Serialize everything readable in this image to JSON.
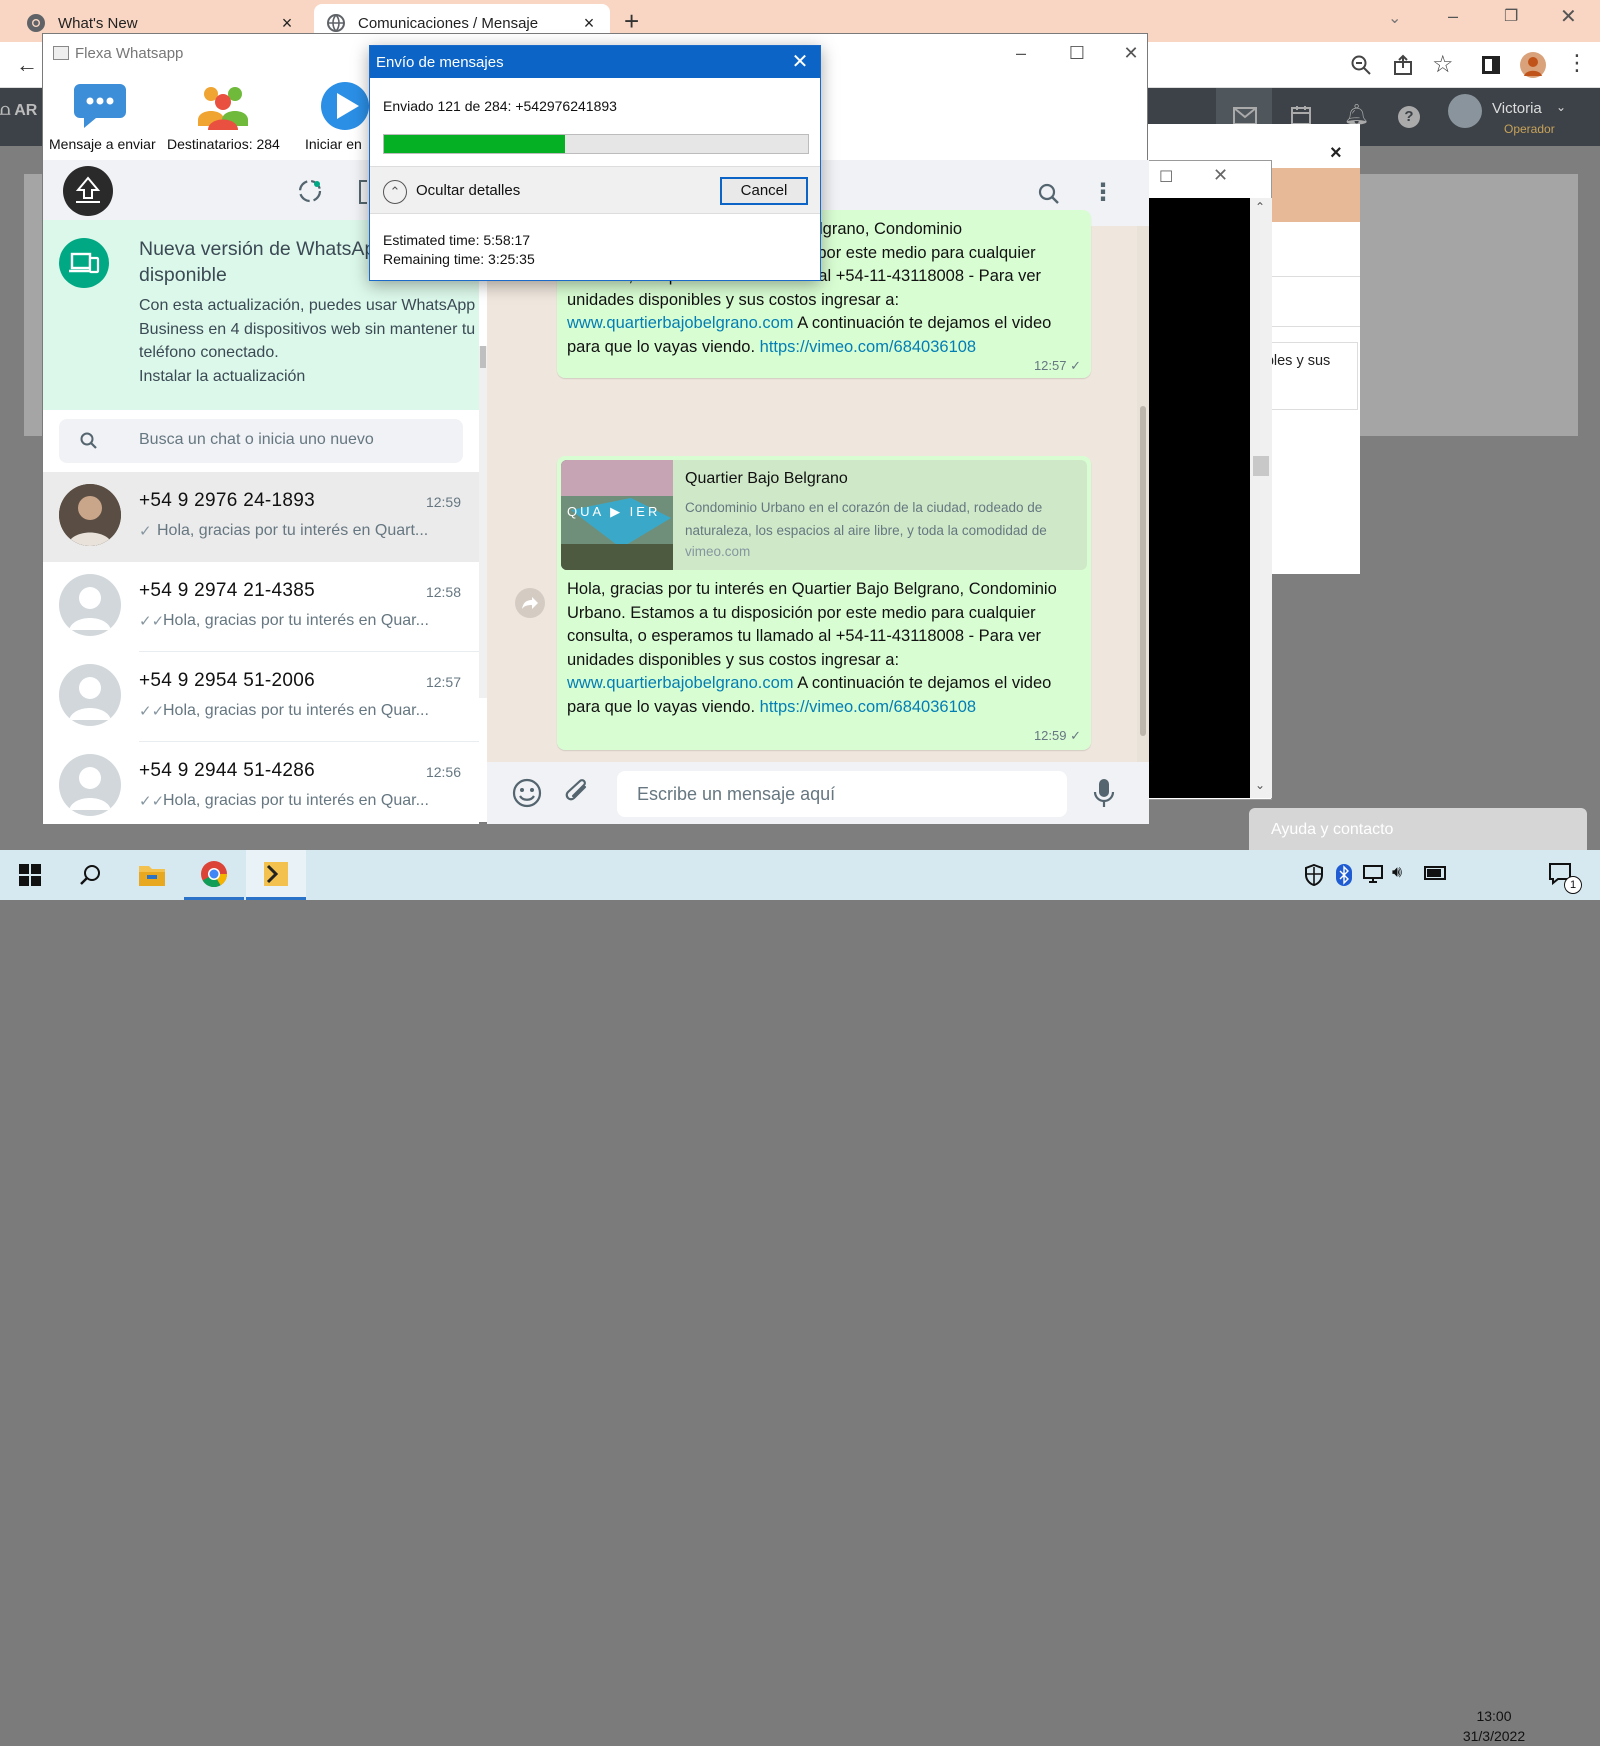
{
  "browser": {
    "tabs": [
      {
        "label": "What's New",
        "close": "×"
      },
      {
        "label": "Comunicaciones / Mensaje",
        "close": "×"
      }
    ],
    "new_tab": "+"
  },
  "web": {
    "user_name": "Victoria",
    "user_role": "Operador",
    "modal_close": "×",
    "behind_text": "unidades disponibles y sus",
    "help": "Ayuda y contacto"
  },
  "flexa": {
    "title": "Flexa Whatsapp",
    "toolbar": [
      {
        "label": "Mensaje a enviar"
      },
      {
        "label": "Destinatarios: 284"
      },
      {
        "label": "Iniciar en"
      }
    ]
  },
  "whatsapp": {
    "banner": {
      "title": "Nueva versión de WhatsApp disponible",
      "body": "Con esta actualización, puedes usar WhatsApp Business en 4 dispositivos web sin mantener tu teléfono conectado.",
      "action": "Instalar la actualización"
    },
    "search_placeholder": "Busca un chat o inicia uno nuevo",
    "chats": [
      {
        "name": "+54 9 2976 24-1893",
        "time": "12:59",
        "message": "Hola, gracias por tu interés en Quart..."
      },
      {
        "name": "+54 9 2974 21-4385",
        "time": "12:58",
        "message": "Hola, gracias por tu interés en Quar..."
      },
      {
        "name": "+54 9 2954 51-2006",
        "time": "12:57",
        "message": "Hola, gracias por tu interés en Quar..."
      },
      {
        "name": "+54 9 2944 51-4286",
        "time": "12:56",
        "message": "Hola, gracias por tu interés en Quar..."
      }
    ],
    "messages": [
      {
        "partial_top": "Quartier Bajo Belgrano, Condominio",
        "text": "Urbano. Estamos a tu disposición por este medio para cualquier\nconsulta, o esperamos tu llamado al +54-11-43118008  - Para ver\nunidades disponibles y sus costos ingresar a:",
        "link1": "www.quartierbajobelgrano.com",
        "middle": " A continuación te dejamos el video",
        "prefix2": "para que lo vayas viendo. ",
        "link2": "https://vimeo.com/684036108",
        "time": "12:57 ✓"
      },
      {
        "preview_title": "Quartier Bajo Belgrano",
        "preview_desc": "Condominio Urbano en el corazón de la ciudad, rodeado de naturaleza, los espacios al aire libre, y toda la comodidad de",
        "preview_domain": "vimeo.com",
        "preview_thumb_text": "QUA ▶ IER",
        "text": "Hola, gracias por tu interés en Quartier Bajo Belgrano, Condominio\nUrbano. Estamos a tu disposición por este medio para cualquier\nconsulta, o esperamos tu llamado al +54-11-43118008  - Para ver\nunidades disponibles y sus costos ingresar a:",
        "link1": "www.quartierbajobelgrano.com",
        "middle": " A continuación te dejamos el video",
        "prefix2": "para que lo vayas viendo. ",
        "link2": "https://vimeo.com/684036108",
        "time": "12:59 ✓"
      }
    ],
    "compose_placeholder": "Escribe un mensaje aquí"
  },
  "dialog": {
    "title": "Envío de mensajes",
    "status": "Enviado 121 de 284: +542976241893",
    "progress": 0.426,
    "details_toggle": "Ocultar detalles",
    "cancel": "Cancel",
    "estimated": "Estimated time: 5:58:17",
    "remaining": "Remaining time: 3:25:35"
  },
  "taskbar": {
    "time": "13:00",
    "date": "31/3/2022",
    "notification_count": "1"
  },
  "colors": {
    "whatsapp_green": "#00a884",
    "dialog_blue": "#0c65c6",
    "progress_green": "#06b025",
    "bubble_green": "#d9fdd3"
  }
}
